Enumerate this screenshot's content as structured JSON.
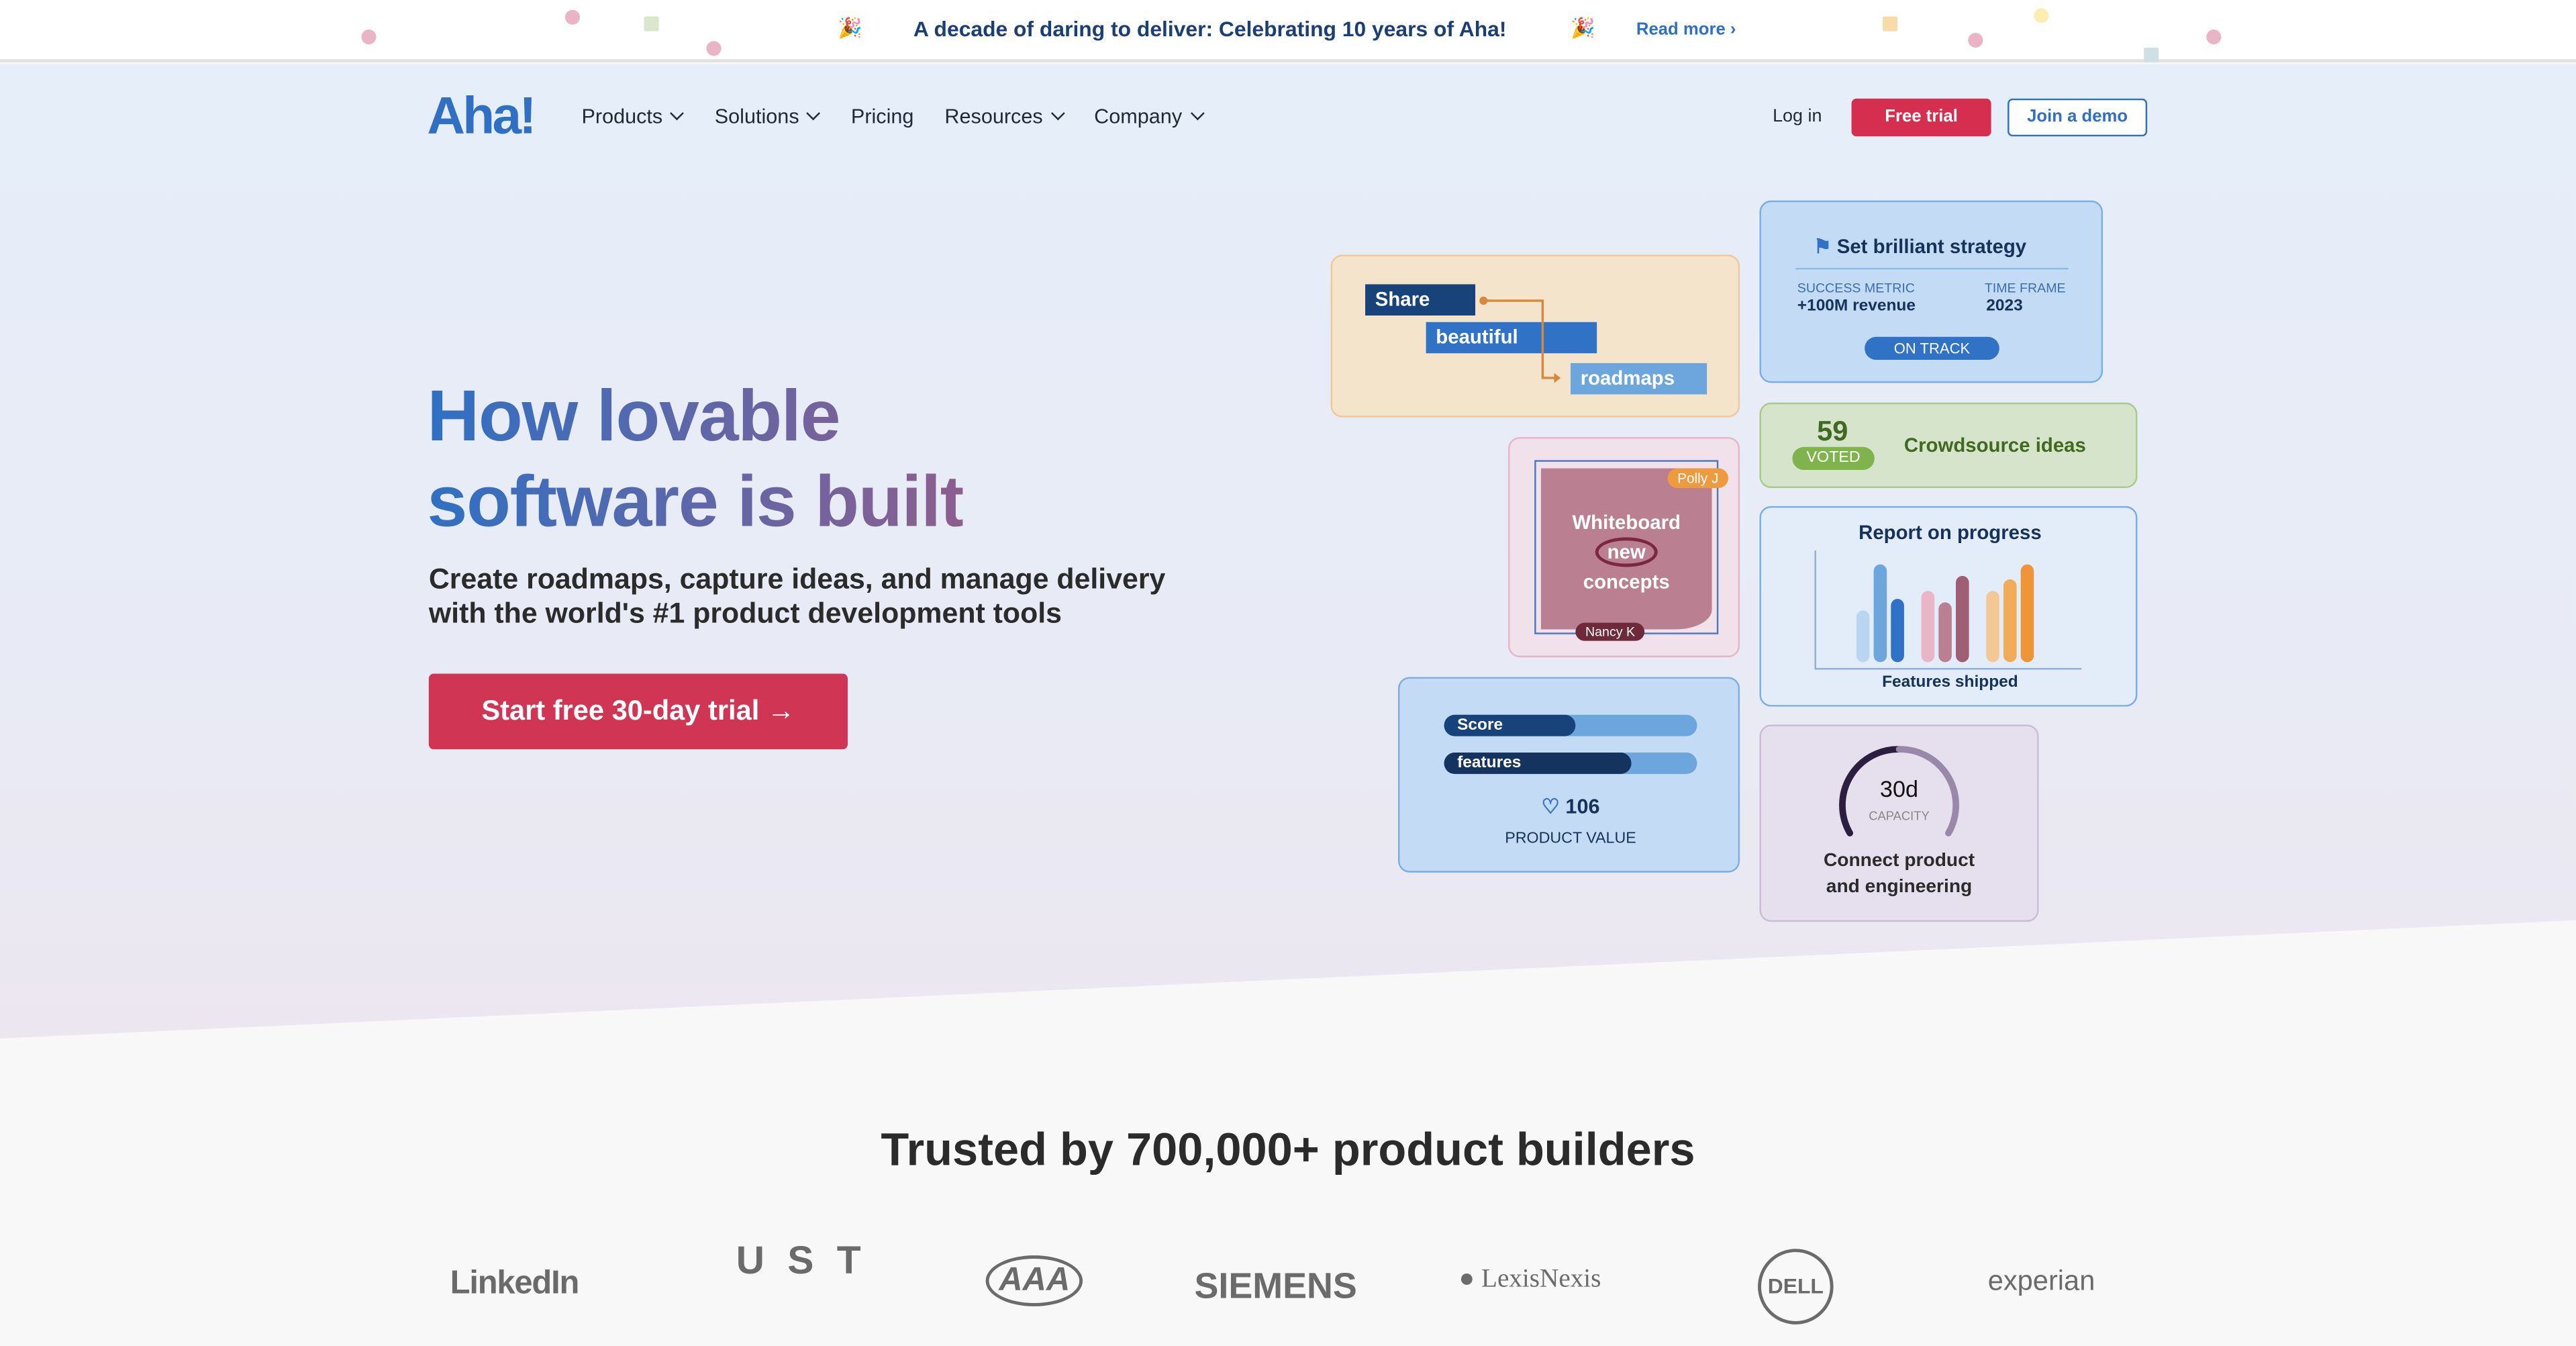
{
  "banner": {
    "text": "A decade of daring to deliver: Celebrating 10 years of Aha!",
    "link": "Read more ›",
    "icon": "party-popper-icon"
  },
  "nav": {
    "logo": "Aha!",
    "items": [
      {
        "label": "Products",
        "dropdown": true
      },
      {
        "label": "Solutions",
        "dropdown": true
      },
      {
        "label": "Pricing",
        "dropdown": false
      },
      {
        "label": "Resources",
        "dropdown": true
      },
      {
        "label": "Company",
        "dropdown": true
      }
    ],
    "login": "Log in",
    "free_trial": "Free trial",
    "demo": "Join a demo"
  },
  "hero": {
    "title_line1": "How lovable",
    "title_line2": "software is built",
    "subtitle_line1": "Create roadmaps, capture ideas, and manage delivery",
    "subtitle_line2": "with the world's #1 product development tools",
    "cta": "Start free 30-day trial →"
  },
  "cards": {
    "roadmap": {
      "bars": [
        "Share",
        "beautiful",
        "roadmaps"
      ]
    },
    "strategy": {
      "title": "Set brilliant strategy",
      "metric_label": "SUCCESS METRIC",
      "metric_value": "+100M revenue",
      "time_label": "TIME FRAME",
      "time_value": "2023",
      "status": "ON TRACK"
    },
    "ideas": {
      "count": "59",
      "badge": "VOTED",
      "title": "Crowdsource ideas"
    },
    "whiteboard": {
      "line1": "Whiteboard",
      "line2": "new",
      "line3": "concepts",
      "user1": "Polly J",
      "user2": "Nancy K"
    },
    "report": {
      "title": "Report on progress",
      "caption": "Features shipped",
      "bar_values": [
        45,
        85,
        55,
        62,
        52,
        75,
        62,
        72,
        85
      ],
      "bar_colors": [
        "#b9d5f2",
        "#6ca6dc",
        "#2f72c6",
        "#e8b6c6",
        "#bb7f92",
        "#a05e74",
        "#f4c894",
        "#f2ab58",
        "#ee9539"
      ]
    },
    "score": {
      "slider1": "Score",
      "slider1_value": 0.52,
      "slider2": "features",
      "slider2_value": 0.74,
      "value": "106",
      "label": "PRODUCT VALUE"
    },
    "capacity": {
      "value": "30d",
      "label": "CAPACITY",
      "title_line1": "Connect product",
      "title_line2": "and engineering"
    }
  },
  "trusted": {
    "title": "Trusted by 700,000+ product builders",
    "logos": [
      "LinkedIn",
      "UST",
      "AAA",
      "SIEMENS",
      "LexisNexis",
      "DELL",
      "experian"
    ]
  },
  "colors": {
    "brand": "#2f70c4",
    "cta": "#d62e4f"
  }
}
